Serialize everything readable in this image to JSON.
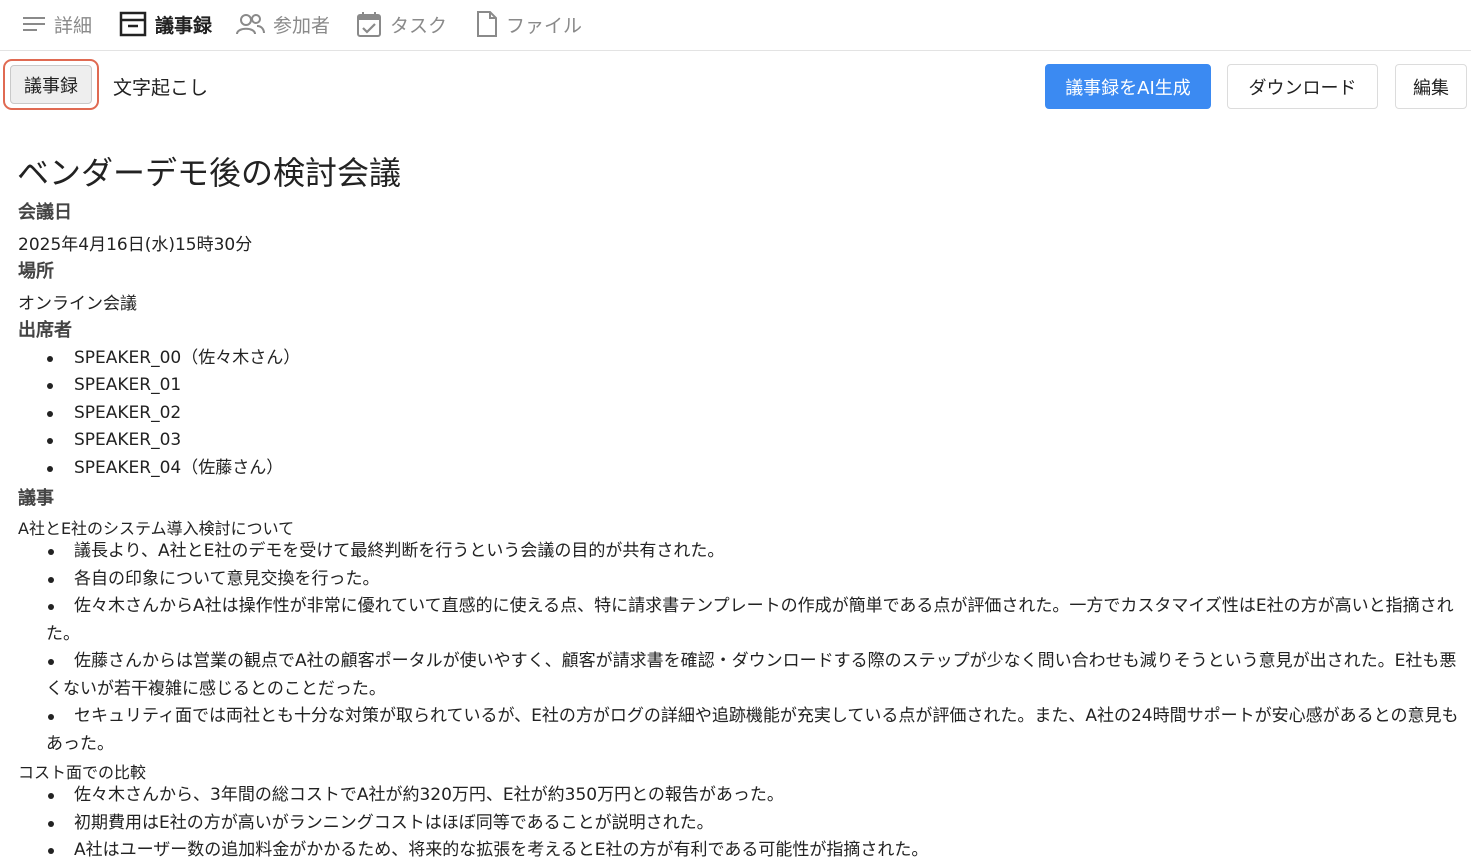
{
  "tabs": [
    {
      "label": "詳細",
      "icon": "list-icon"
    },
    {
      "label": "議事録",
      "icon": "minutes-icon",
      "active": true
    },
    {
      "label": "参加者",
      "icon": "people-icon"
    },
    {
      "label": "タスク",
      "icon": "calendar-check-icon"
    },
    {
      "label": "ファイル",
      "icon": "file-icon"
    }
  ],
  "toolbar": {
    "subtabs": [
      "議事録",
      "文字起こし"
    ],
    "generate_label": "議事録をAI生成",
    "download_label": "ダウンロード",
    "edit_label": "編集",
    "accent_color": "#3b8af2"
  },
  "doc": {
    "title": "ベンダーデモ後の検討会議",
    "date_label": "会議日",
    "date_value": "2025年4月16日(水)15時30分",
    "place_label": "場所",
    "place_value": "オンライン会議",
    "attendees_label": "出席者",
    "attendees": [
      "SPEAKER_00（佐々木さん）",
      "SPEAKER_01",
      "SPEAKER_02",
      "SPEAKER_03",
      "SPEAKER_04（佐藤さん）"
    ],
    "agenda_label": "議事",
    "section1_title": "A社とE社のシステム導入検討について",
    "section1_items": [
      "議長より、A社とE社のデモを受けて最終判断を行うという会議の目的が共有された。",
      "各自の印象について意見交換を行った。",
      "佐々木さんからA社は操作性が非常に優れていて直感的に使える点、特に請求書テンプレートの作成が簡単である点が評価された。一方でカスタマイズ性はE社の方が高いと指摘された。",
      "佐藤さんからは営業の観点でA社の顧客ポータルが使いやすく、顧客が請求書を確認・ダウンロードする際のステップが少なく問い合わせも減りそうという意見が出された。E社も悪くないが若干複雑に感じるとのことだった。",
      "セキュリティ面では両社とも十分な対策が取られているが、E社の方がログの詳細や追跡機能が充実している点が評価された。また、A社の24時間サポートが安心感があるとの意見もあった。"
    ],
    "section2_title": "コスト面での比較",
    "section2_items": [
      "佐々木さんから、3年間の総コストでA社が約320万円、E社が約350万円との報告があった。",
      "初期費用はE社の方が高いがランニングコストはほぼ同等であることが説明された。",
      "A社はユーザー数の追加料金がかかるため、将来的な拡張を考えるとE社の方が有利である可能性が指摘された。"
    ]
  }
}
